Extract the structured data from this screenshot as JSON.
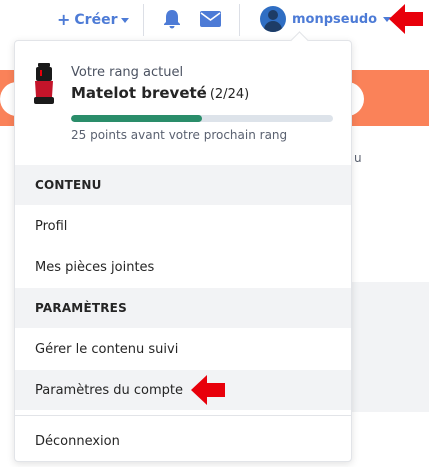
{
  "topbar": {
    "create_label": "Créer",
    "create_icon": "plus-icon",
    "notifications_icon": "bell-icon",
    "messages_icon": "envelope-icon",
    "username": "monpseudo",
    "accent_color": "#4d7bd6"
  },
  "rank": {
    "label": "Votre rang actuel",
    "name": "Matelot breveté",
    "count": "(2/24)",
    "progress_fraction": 0.5,
    "progress_text": "25 points avant votre prochain rang",
    "progress_color": "#2a8d6a"
  },
  "menu": {
    "content_header": "CONTENU",
    "profile": "Profil",
    "attachments": "Mes pièces jointes",
    "settings_header": "PARAMÈTRES",
    "followed_content": "Gérer le contenu suivi",
    "account_settings": "Paramètres du compte",
    "logout": "Déconnexion"
  },
  "background": {
    "partial_text": "u",
    "banner_color": "#fa8259"
  },
  "annotations": {
    "arrow_color": "#e8000b"
  }
}
